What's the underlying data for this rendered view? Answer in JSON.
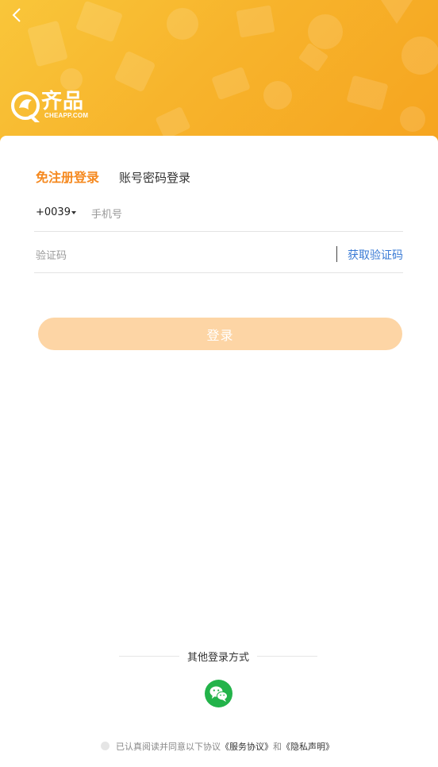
{
  "header": {
    "back_icon": "chevron-left-icon",
    "logo": {
      "name": "齐品",
      "sub": "CHEAPP.COM"
    },
    "background_color": "#f7b42c"
  },
  "tabs": [
    {
      "label": "免注册登录",
      "active": true
    },
    {
      "label": "账号密码登录",
      "active": false
    }
  ],
  "phone": {
    "country_code": "+0039",
    "placeholder": "手机号",
    "value": ""
  },
  "code": {
    "placeholder": "验证码",
    "value": "",
    "get_code_label": "获取验证码"
  },
  "login_button": {
    "label": "登录",
    "color": "#fdd5a5"
  },
  "other_login": {
    "label": "其他登录方式",
    "wechat_icon": "wechat-icon",
    "wechat_color": "#23b34a"
  },
  "agreement": {
    "text": "已认真阅读并同意以下协议",
    "service_link": "《服务协议》",
    "and": "和",
    "privacy_link": "《隐私声明》"
  },
  "accent_color": "#f5891f",
  "link_color": "#3a7bd5"
}
